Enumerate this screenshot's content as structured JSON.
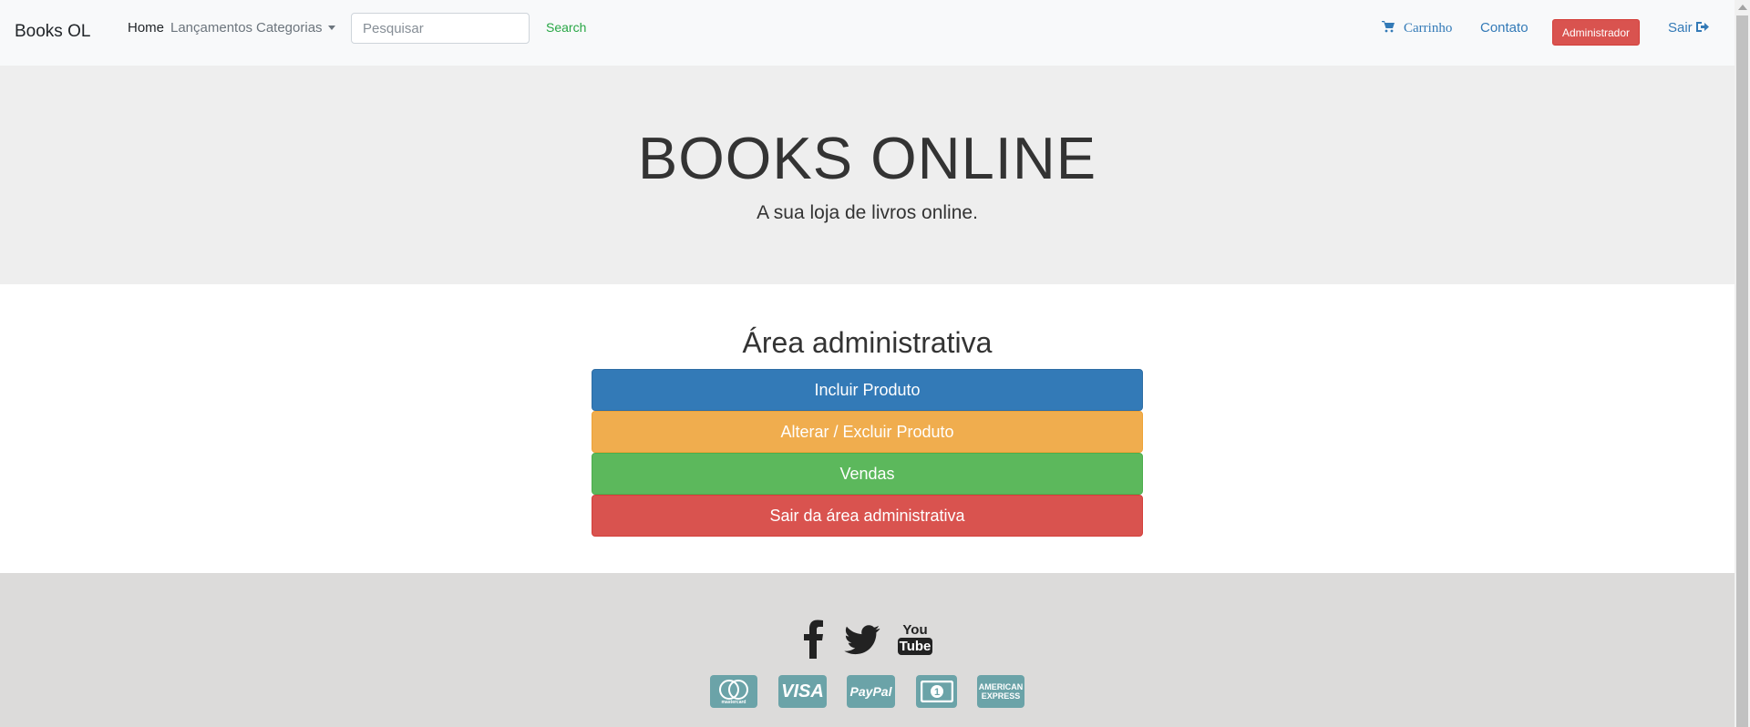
{
  "navbar": {
    "brand": "Books OL",
    "links": {
      "home": "Home",
      "lancamentos": "Lançamentos",
      "categorias": "Categorias"
    },
    "search": {
      "placeholder": "Pesquisar",
      "value": "",
      "button": "Search"
    },
    "cart": "Carrinho",
    "contato": "Contato",
    "admin": "Administrador",
    "sair": "Sair"
  },
  "hero": {
    "title": "BOOKS ONLINE",
    "subtitle": "A sua loja de livros online."
  },
  "admin": {
    "title": "Área administrativa",
    "buttons": {
      "incluir": "Incluir Produto",
      "alterar": "Alterar / Excluir Produto",
      "vendas": "Vendas",
      "sair": "Sair da área administrativa"
    }
  },
  "footer": {
    "social": [
      "facebook-icon",
      "twitter-icon",
      "youtube-icon"
    ],
    "youtube_text": [
      "You",
      "Tube"
    ],
    "payments": {
      "mastercard": "mastercard",
      "visa": "VISA",
      "paypal": "PayPal",
      "cash": "1",
      "amex": [
        "AMERICAN",
        "EXPRESS"
      ]
    }
  },
  "colors": {
    "primary": "#337ab7",
    "warning": "#f0ad4e",
    "success": "#5cb85c",
    "danger": "#d9534f",
    "payment_badge": "#6ba3a8"
  }
}
